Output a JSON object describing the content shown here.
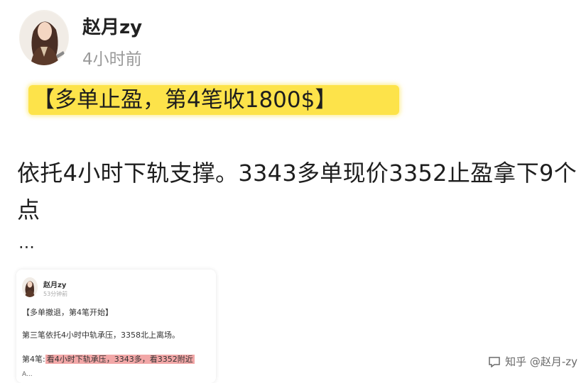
{
  "author": {
    "name": "赵月zy",
    "time": "4小时前"
  },
  "post": {
    "title": "【多单止盈，第4笔收1800$】",
    "body": "依托4小时下轨支撑。3343多单现价3352止盈拿下9个点",
    "ellipsis": "..."
  },
  "preview": {
    "name": "赵月zy",
    "time": "53分钟前",
    "line1": "【多单撤退，第4笔开始】",
    "line2": "第三笔依托4小时中轨承压，3358北上离场。",
    "line3_prefix": "第4笔:",
    "line3_mark": "看4小时下轨承压，3343多，看3352附近",
    "line4": "A..."
  },
  "watermark": {
    "text": "知乎 @赵月-zy"
  },
  "colors": {
    "highlight": "#fde34a",
    "mark": "#f2a7a7"
  }
}
